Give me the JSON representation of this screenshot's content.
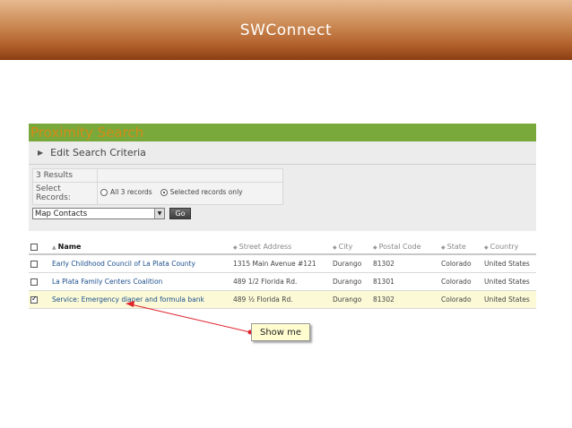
{
  "banner": {
    "title": "SWConnect"
  },
  "panel": {
    "title": "Proximity Search",
    "criteria_label": "Edit Search Criteria"
  },
  "options": {
    "results_count": "3 Results",
    "select_records_label_1": "Select",
    "select_records_label_2": "Records:",
    "radio_all": "All 3 records",
    "radio_selected": "Selected records only",
    "selected_radio": "selected",
    "action_select_value": "Map Contacts",
    "go_label": "Go"
  },
  "table": {
    "headers": [
      "Name",
      "Street Address",
      "City",
      "Postal Code",
      "State",
      "Country"
    ],
    "rows": [
      {
        "name": "Early Childhood Council of La Plata County",
        "street": "1315 Main Avenue #121",
        "city": "Durango",
        "postal": "81302",
        "state": "Colorado",
        "country": "United States",
        "checked": false
      },
      {
        "name": "La Plata Family Centers Coalition",
        "street": "489 1/2 Florida Rd.",
        "city": "Durango",
        "postal": "81301",
        "state": "Colorado",
        "country": "United States",
        "checked": false
      },
      {
        "name": "Service: Emergency diaper and formula bank",
        "street": "489 ½ Florida Rd.",
        "city": "Durango",
        "postal": "81302",
        "state": "Colorado",
        "country": "United States",
        "checked": true
      }
    ]
  },
  "callout": {
    "label": "Show me",
    "color": "#e0202a"
  },
  "colors": {
    "banner": "#b2602c",
    "panel_header": "#79a93b",
    "panel_title": "#d48a17",
    "link": "#1b4f8c",
    "selected_row": "#fbf9d6"
  }
}
